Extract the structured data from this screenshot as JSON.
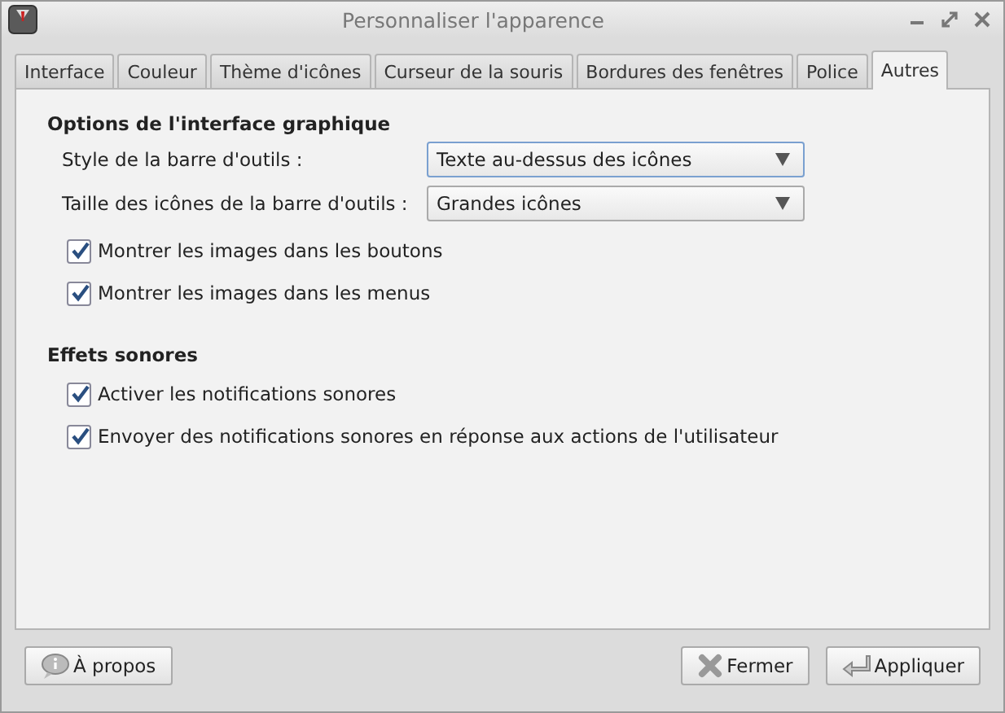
{
  "window": {
    "title": "Personnaliser l'apparence"
  },
  "tabs": [
    {
      "label": "Interface",
      "selected": false
    },
    {
      "label": "Couleur",
      "selected": false
    },
    {
      "label": "Thème d'icônes",
      "selected": false
    },
    {
      "label": "Curseur de la souris",
      "selected": false
    },
    {
      "label": "Bordures des fenêtres",
      "selected": false
    },
    {
      "label": "Police",
      "selected": false
    },
    {
      "label": "Autres",
      "selected": true
    }
  ],
  "sections": [
    {
      "title": "Options de l'interface graphique",
      "rows": [
        {
          "kind": "combo",
          "label": "Style de la barre d'outils :",
          "value": "Texte au-dessus des icônes",
          "focused": true
        },
        {
          "kind": "combo",
          "label": "Taille des icônes de la barre d'outils :",
          "value": "Grandes icônes",
          "focused": false
        },
        {
          "kind": "check",
          "label": "Montrer les images dans les boutons",
          "checked": true
        },
        {
          "kind": "check",
          "label": "Montrer les images dans les menus",
          "checked": true
        }
      ]
    },
    {
      "title": "Effets sonores",
      "rows": [
        {
          "kind": "check",
          "label": "Activer les notifications sonores",
          "checked": true
        },
        {
          "kind": "check",
          "label": "Envoyer des notifications sonores en réponse aux actions de l'utilisateur",
          "checked": true
        }
      ]
    }
  ],
  "buttons": [
    {
      "label": "À propos",
      "kind": "about"
    },
    {
      "label": "Fermer",
      "kind": "close"
    },
    {
      "label": "Appliquer",
      "kind": "apply"
    }
  ]
}
